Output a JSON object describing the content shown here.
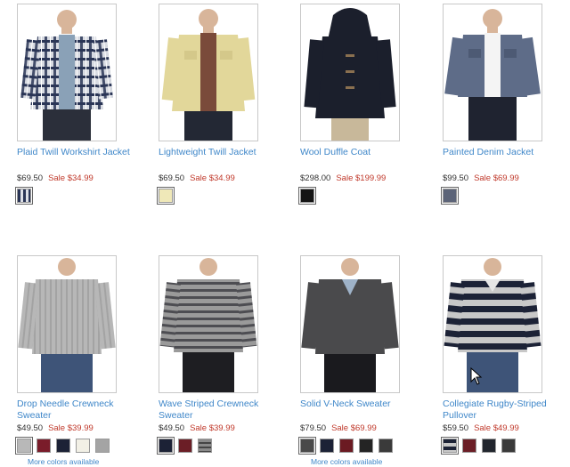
{
  "products": [
    {
      "name": "Plaid Twill Workshirt Jacket",
      "orig_price": "$69.50",
      "sale_price": "Sale $34.99",
      "icon": "plaid-jacket-photo",
      "swatches": [
        "#5a6a88"
      ]
    },
    {
      "name": "Lightweight Twill Jacket",
      "orig_price": "$69.50",
      "sale_price": "Sale $34.99",
      "icon": "khaki-jacket-photo",
      "swatches": [
        "#efe8b8"
      ]
    },
    {
      "name": "Wool Duffle Coat",
      "orig_price": "$298.00",
      "sale_price": "Sale $199.99",
      "icon": "duffle-coat-photo",
      "swatches": [
        "#141414"
      ]
    },
    {
      "name": "Painted Denim Jacket",
      "orig_price": "$99.50",
      "sale_price": "Sale $69.99",
      "icon": "denim-jacket-photo",
      "swatches": [
        "#5c6478"
      ]
    },
    {
      "name": "Drop Needle Crewneck Sweater",
      "orig_price": "$49.50",
      "sale_price": "Sale $39.99",
      "icon": "gray-crewneck-photo",
      "swatches": [
        "#b8b8b8",
        "#7a1c2a",
        "#1c2236",
        "#f2f0e6",
        "#a4a4a4"
      ],
      "more": "More colors available"
    },
    {
      "name": "Wave Striped Crewneck Sweater",
      "orig_price": "$49.50",
      "sale_price": "Sale $39.99",
      "icon": "striped-crewneck-photo",
      "swatches": [
        "#1c2236",
        "#6b1e26",
        "#8a8a8a"
      ]
    },
    {
      "name": "Solid V-Neck Sweater",
      "orig_price": "$79.50",
      "sale_price": "Sale $69.99",
      "icon": "vneck-sweater-photo",
      "swatches": [
        "#4a4a4a",
        "#1c2236",
        "#6b1a22",
        "#242424",
        "#3a3a3a"
      ],
      "more": "More colors available"
    },
    {
      "name": "Collegiate Rugby-Striped Pullover",
      "orig_price": "$59.50",
      "sale_price": "Sale $49.99",
      "icon": "rugby-pullover-photo",
      "swatches": [
        "#1c2236",
        "#6b1e26",
        "#22262e",
        "#3a3a3a"
      ]
    }
  ],
  "colors": {
    "link": "#3f87c9",
    "sale": "#c0392b",
    "price": "#333333"
  }
}
